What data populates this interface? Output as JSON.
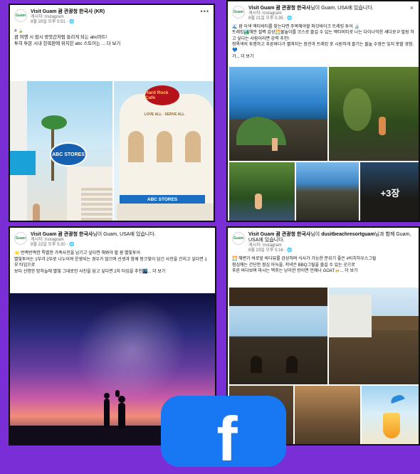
{
  "posts": [
    {
      "page_name": "Visit Guam 괌 관광청 한국사 (KR)",
      "page_name_bold": "",
      "sub1": "게시자: Instagram",
      "sub2": "8월 20일 오후 5:51 · ",
      "body": [
        "# 🍃",
        "괌 여행 시 잠시 방앗간처럼 들리게 되는 abc마트!",
        "투히 투몬 시내 한복판에 위치한 abc 스토어는 ... 더 보기"
      ],
      "image_texts": [
        "ABC STORES",
        "Hard Rock Cafe",
        "LOVE ALL · SERVE ALL",
        "ABC STORES"
      ]
    },
    {
      "page_name": "Visit Guam 괌 관광청 한국사",
      "page_name_suffix": "님이 Guam, USA에 있습니다.",
      "sub1": "게시자: Instagram",
      "sub2": "8월 21일 오후 5:35 · ",
      "body": [
        "🌊 괌 이색 액티비티를 찾는다면 주목해야할 파갓바이크 트레킹 투어 🔬",
        "트레킹🏞️해안 절벽 감상🌅물놀이를 코스로 즐길 수 있는 액티비티로 나는 다이나믹한 섀다로 P 필링 하고 싶다는 사람이라면 강력 추천!",
        "청록색의 투명하고 푸른바다가 펼쳐지는 장관과 트레킹 포 시원하게 즐기는 물놀 수영은 잊지 못할 경험.💙",
        "가... 더 보기"
      ],
      "more_photos": "+3장"
    },
    {
      "page_name": "Visit Guam 괌 관광청 한국사",
      "page_name_suffix": "님이 Guam, USA에 있습니다.",
      "sub1": "게시자: Instagram",
      "sub2": "8월 22일 오후 5:20 · ",
      "body": [
        "🌟 반짝반짝한 특별한 가족사진을 남기고 싶다면 해봐야 할 괌 별빛투어",
        "별빛투어는 1부과 2부로 나누어져 운영되는 경우가 많으며 선셋과 함께 핑크빛이 담긴 사진을 건지고 싶다면 1부 타임으로",
        "보다 선명한 밤하늘에 별빛 그대로인 사진을 담고 싶다면 2차 타임을 추천🌃... 더 보기"
      ]
    },
    {
      "page_name": "Visit Guam 괌 관광청 한국사",
      "page_name_mid": "님이 ",
      "page_name_with": "dusitbeachresortguam",
      "page_name_suffix": "님과 함께 Guam, USA에 있습니다.",
      "sub1": "게시자: Instagram",
      "sub2": "8월 23일 오후 5:16 · ",
      "body": [
        "🌅 해변가 바로앞 바다뷰를 감상하며 식사가 가능한 분위기 좋은 #비치하우스그릴",
        "점심에는 간단한 점심 아늑을, 저녁은 BBQ그릴을 즐길 수 있는 곳으로",
        "푸른 바다보며 마시는 맥주는 낭이한 방이면 언제나 GOAT🍻... 더 보기"
      ]
    }
  ],
  "overlay": {
    "logo_letter": "f"
  }
}
